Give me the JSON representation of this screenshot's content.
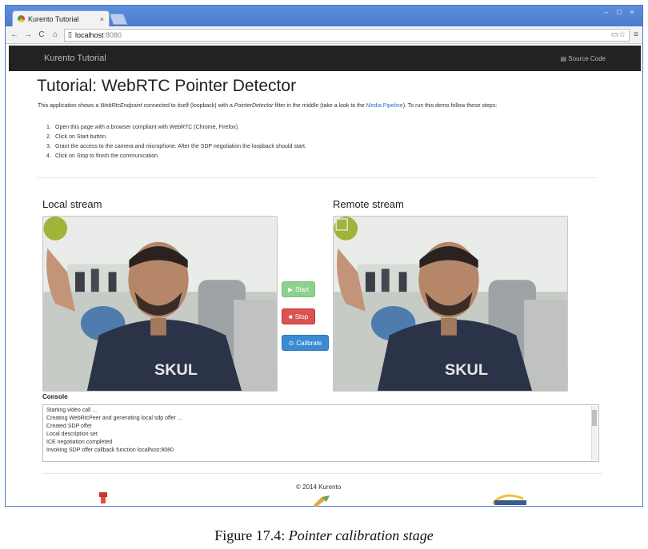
{
  "browser": {
    "tab_title": "Kurento Tutorial",
    "tab_close": "×",
    "url_host": "localhost",
    "url_port": ":8080",
    "window_controls": [
      "–",
      "□",
      "×"
    ]
  },
  "navbar": {
    "brand": "Kurento Tutorial",
    "source_code_label": "Source Code"
  },
  "page": {
    "title": "Tutorial: WebRTC Pointer Detector",
    "intro_before": "This application shows a ",
    "intro_em1": "WebRtcEndpoint",
    "intro_mid1": " connected to itself (loopback) with a ",
    "intro_em2": "PointerDetector",
    "intro_mid2": " filter in the middle (take a look to the ",
    "intro_link": "Media Pipeline",
    "intro_after": "). To run this demo follow these steps:",
    "steps": [
      {
        "n": "1.",
        "text": "Open this page with a browser compliant with WebRTC (Chrome, Firefox)."
      },
      {
        "n": "2.",
        "text": "Click on Start button."
      },
      {
        "n": "3.",
        "text": "Grant the access to the camera and microphone. After the SDP negotiation the loopback should start."
      },
      {
        "n": "4.",
        "text": "Click on Stop to finish the communication."
      }
    ],
    "local_label": "Local stream",
    "remote_label": "Remote stream",
    "buttons": {
      "start": "Start",
      "stop": "Stop",
      "calibrate": "Calibrate"
    },
    "console_label": "Console",
    "console_lines": [
      "Starting video call ...",
      "Creating WebRtcPeer and generating local sdp offer ...",
      "Created SDP offer",
      "Local description set",
      "ICE negotiation completed",
      "Invoking SDP offer callback function localhost:8080"
    ],
    "footer": "© 2014 Kurento"
  },
  "caption": {
    "prefix": "Figure 17.4: ",
    "text": "Pointer calibration stage"
  },
  "colors": {
    "navbar": "#222222",
    "start": "#8fd08f",
    "stop": "#d9534f",
    "calibrate": "#3a8bd1",
    "link": "#2a6fc9"
  }
}
